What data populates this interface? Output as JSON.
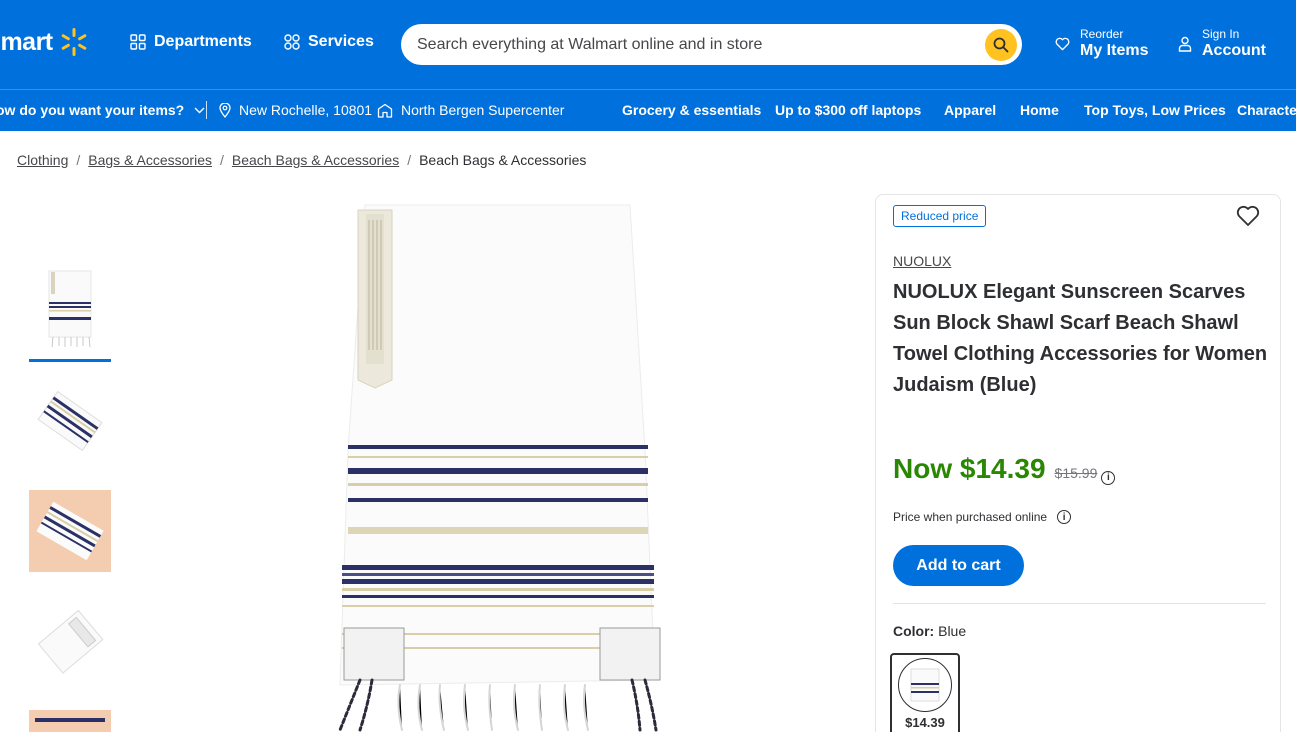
{
  "header": {
    "logo_text": "lmart",
    "departments_label": "Departments",
    "services_label": "Services",
    "search_placeholder": "Search everything at Walmart online and in store",
    "reorder_small": "Reorder",
    "reorder_big": "My Items",
    "signin_small": "Sign In",
    "signin_big": "Account",
    "colors": {
      "brand_blue": "#0071dc",
      "spark_yellow": "#ffc220"
    }
  },
  "subnav": {
    "delivery_prompt": "ow do you want your items?",
    "location": "New Rochelle, 10801",
    "store": "North Bergen Supercenter",
    "links": [
      "Grocery & essentials",
      "Up to $300 off laptops",
      "Apparel",
      "Home",
      "Top Toys, Low Prices",
      "Character"
    ]
  },
  "breadcrumb": {
    "items": [
      "Clothing",
      "Bags & Accessories",
      "Beach Bags & Accessories"
    ],
    "current": "Beach Bags & Accessories"
  },
  "product": {
    "badge": "Reduced price",
    "brand": "NUOLUX",
    "title": "NUOLUX Elegant Sunscreen Scarves Sun Block Shawl Scarf Beach Shawl Towel Clothing Accessories for Women Judaism (Blue)",
    "now_price": "Now $14.39",
    "was_price": "$15.99",
    "price_note": "Price when purchased online",
    "add_to_cart": "Add to cart",
    "color_label": "Color:",
    "color_value": "Blue",
    "swatch_price": "$14.39",
    "price_color": "#2a8703"
  }
}
